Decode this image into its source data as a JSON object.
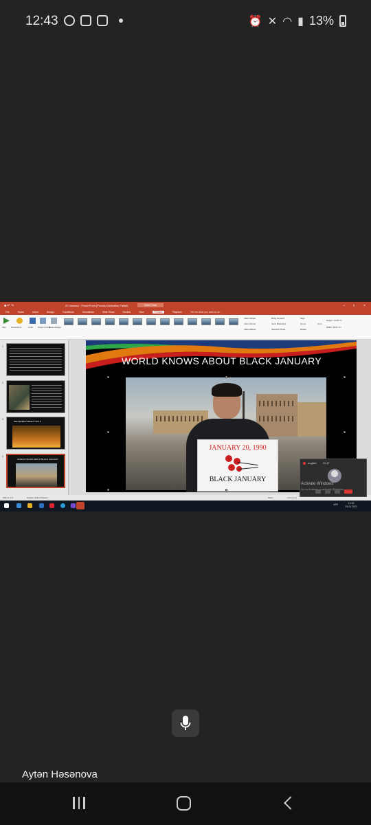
{
  "status_bar": {
    "time": "12:43",
    "battery": "13%"
  },
  "powerpoint": {
    "document_title": "20 January - PowerPoint (Product Activation Failed)",
    "tools_tab": "Video Tools",
    "tabs": [
      "File",
      "Home",
      "Insert",
      "Design",
      "Transitions",
      "Animations",
      "Slide Show",
      "Review",
      "View",
      "Format",
      "Playback"
    ],
    "tell_me": "Tell me what you want to do...",
    "ribbon_buttons": [
      "Play",
      "Corrections",
      "Color",
      "Poster Frame",
      "Reset Design"
    ],
    "ribbon_right": [
      "Video Shape",
      "Video Border",
      "Video Effects",
      "Bring Forward",
      "Send Backward",
      "Selection Pane",
      "Align",
      "Group",
      "Rotate",
      "Crop"
    ],
    "height_label": "Height: 14.28 cm",
    "width_label": "Width: 25.07 cm",
    "slide_title": "WORLD  KNOWS ABOUT BLACK JANUARY",
    "sign_date": "JANUARY 20, 1990",
    "sign_text": "BLACK JANUARY",
    "thumb_title": "WORLD KNOWS ABOUT BLACK JANUARY",
    "thumb_red_title": "WE NEVER FORGET THIS !!!",
    "status_left": "Slide 4 of 4",
    "status_lang": "English (United States)",
    "status_notes": "Notes",
    "status_comments": "Comments",
    "clock_time": "12:42",
    "clock_date": "19.01.2021",
    "lang": "AZE"
  },
  "meeting_tile": {
    "name": "english",
    "duration": "21:17",
    "activate_title": "Activate Windows",
    "activate_sub": "Go to Settings to activate Windows."
  },
  "call": {
    "speaker_name": "Aytən Həsənova"
  },
  "icons": [
    "whatsapp-icon",
    "teams-icon",
    "gallery-icon",
    "alarm-icon",
    "mute-icon",
    "wifi-icon",
    "signal-icon",
    "battery-icon",
    "mic-icon",
    "recent-apps-icon",
    "home-icon",
    "back-icon"
  ]
}
